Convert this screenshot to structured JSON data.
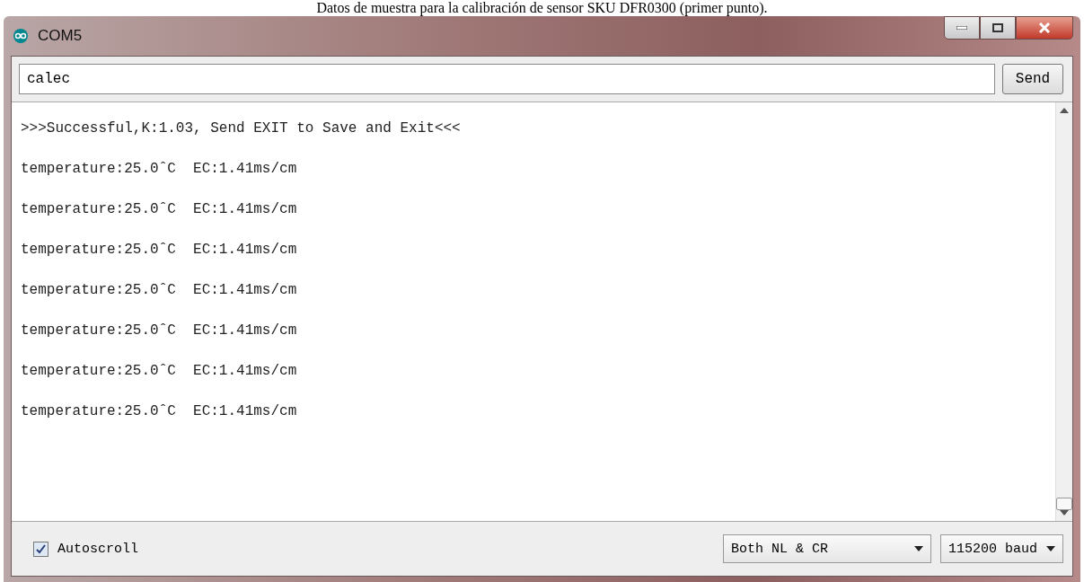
{
  "caption": "Datos de muestra para la calibración de sensor SKU DFR0300 (primer punto).",
  "window": {
    "title": "COM5"
  },
  "input": {
    "value": "calec"
  },
  "send_button": "Send",
  "output_lines": [
    ">>>Successful,K:1.03, Send EXIT to Save and Exit<<<",
    "temperature:25.0ˆC  EC:1.41ms/cm",
    "temperature:25.0ˆC  EC:1.41ms/cm",
    "temperature:25.0ˆC  EC:1.41ms/cm",
    "temperature:25.0ˆC  EC:1.41ms/cm",
    "temperature:25.0ˆC  EC:1.41ms/cm",
    "temperature:25.0ˆC  EC:1.41ms/cm",
    "temperature:25.0ˆC  EC:1.41ms/cm"
  ],
  "autoscroll": {
    "label": "Autoscroll",
    "checked": true
  },
  "line_ending": "Both NL & CR",
  "baud_rate": "115200 baud"
}
